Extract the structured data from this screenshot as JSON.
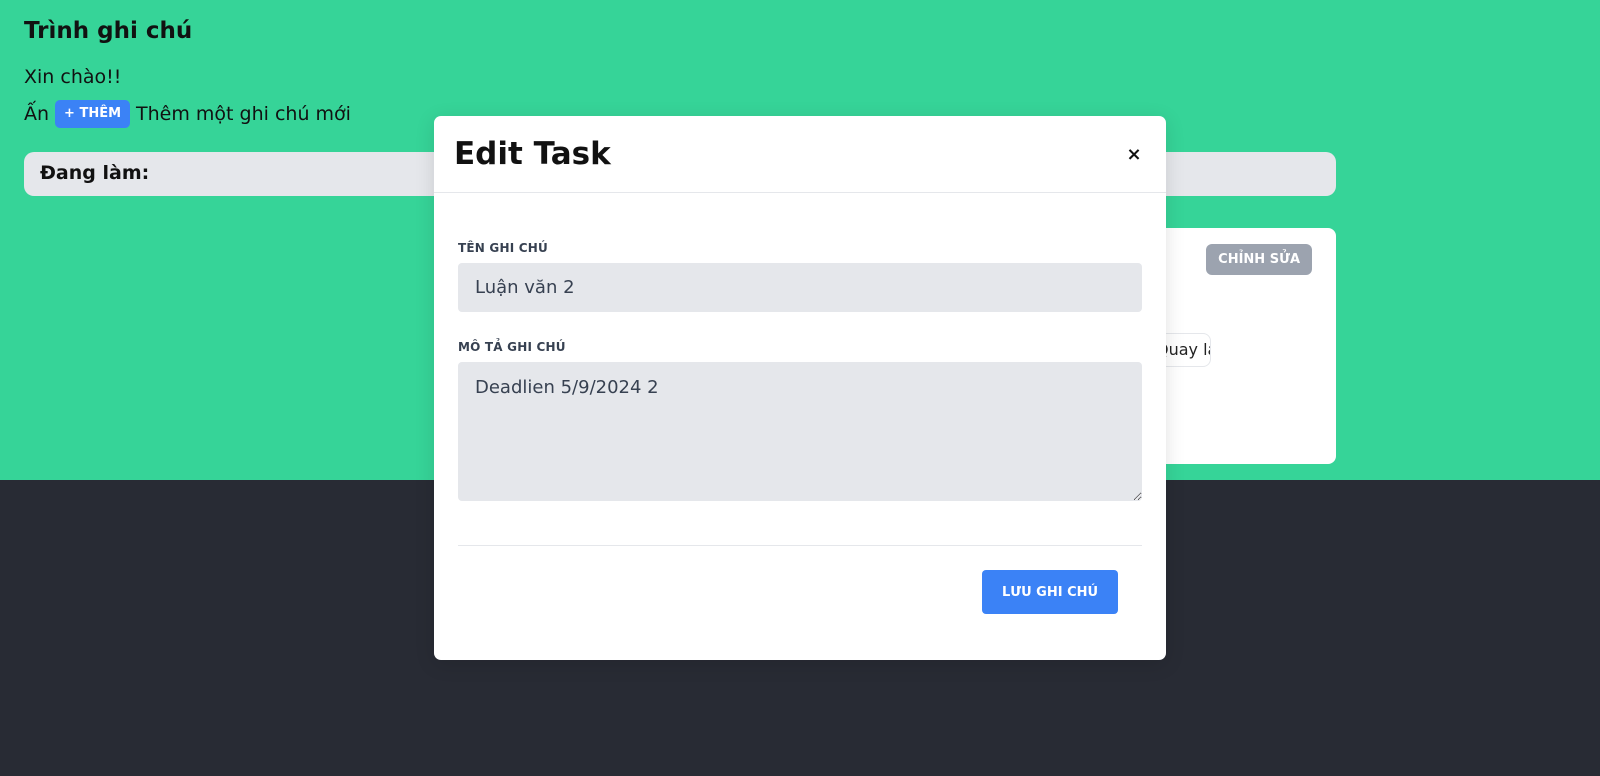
{
  "app": {
    "title": "Trình ghi chú",
    "greeting": "Xin chào!!",
    "hint_prefix": "Ấn",
    "add_button_label": "+ THÊM",
    "hint_suffix": "Thêm một ghi chú mới"
  },
  "board": {
    "doing_label": "Đang làm:"
  },
  "task_card": {
    "edit_label": "CHỈNH SỬA",
    "back_label": "Quay lại"
  },
  "modal": {
    "title": "Edit Task",
    "close_icon": "×",
    "name_label": "TÊN GHI CHÚ",
    "name_value": "Luận văn 2",
    "description_label": "MÔ TẢ GHI CHÚ",
    "description_value": "Deadlien 5/9/2024 2",
    "save_label": "LƯU GHI CHÚ"
  }
}
